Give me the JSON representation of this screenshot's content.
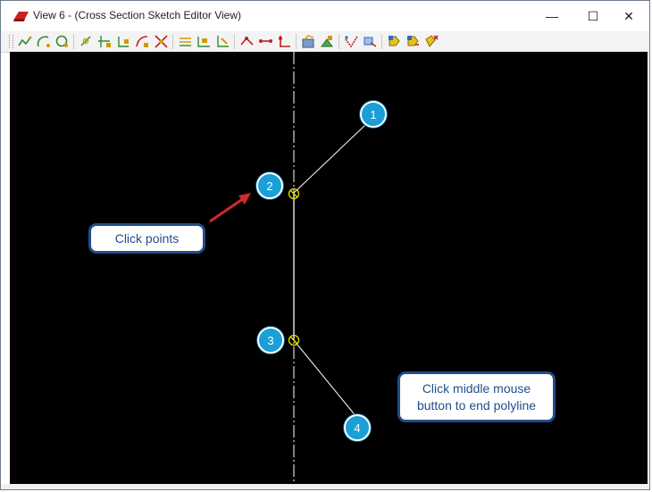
{
  "window": {
    "title": "View 6 - (Cross Section Sketch Editor View)",
    "controls": {
      "minimize": "—",
      "maximize": "☐",
      "close": "✕"
    },
    "accent_color": "#cc2222"
  },
  "toolbar": {
    "groups": [
      [
        "polyline-tool-icon",
        "arc-tool-icon",
        "circle-tool-icon"
      ],
      [
        "snap-point-icon",
        "snap-node-icon",
        "snap-end-icon",
        "snap-curve-icon",
        "snap-intersect-icon"
      ],
      [
        "edit-line-icon",
        "edit-node-icon",
        "edit-segment-icon"
      ],
      [
        "insert-node-icon",
        "move-node-icon",
        "delete-node-icon"
      ],
      [
        "fill-icon",
        "paint-icon"
      ],
      [
        "select-icon",
        "transform-icon"
      ],
      [
        "tag-icon",
        "tag-edit-icon",
        "tag-delete-icon"
      ]
    ]
  },
  "canvas": {
    "background": "#000000",
    "markers": [
      {
        "label": "1"
      },
      {
        "label": "2"
      },
      {
        "label": "3"
      },
      {
        "label": "4"
      }
    ],
    "callouts": {
      "click_points": "Click points",
      "end_polyline_line1": "Click middle mouse",
      "end_polyline_line2": "button to end polyline"
    },
    "marker_color": "#1a9fd6",
    "callout_border_color": "#1f4e8c",
    "snap_color": "#e8e000",
    "arrow_color": "#d02a2a"
  }
}
